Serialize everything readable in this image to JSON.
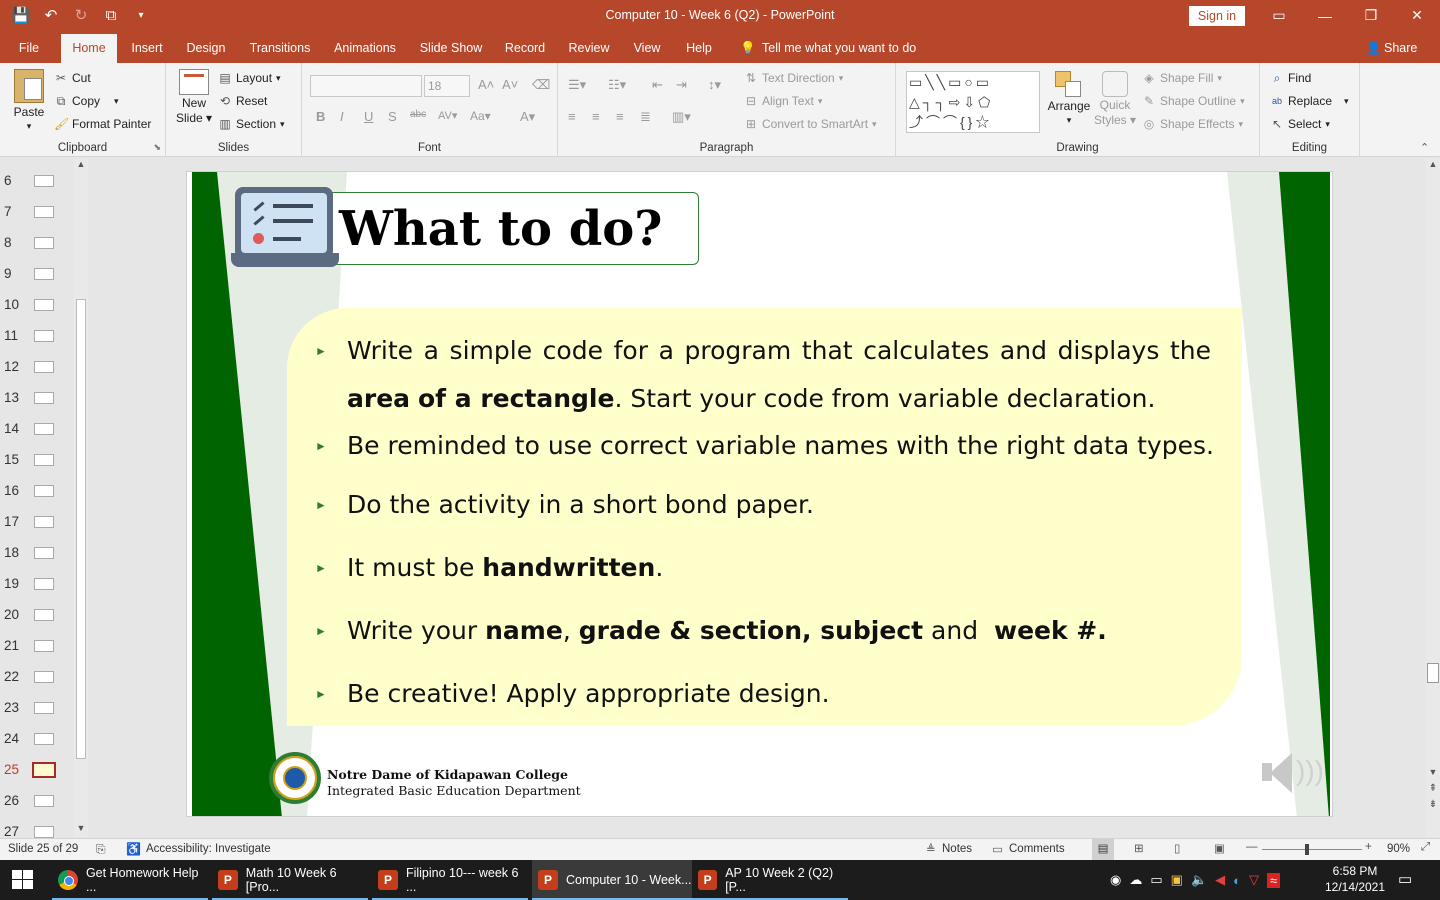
{
  "window": {
    "title": "Computer 10 - Week 6 (Q2)  -  PowerPoint",
    "sign_in": "Sign in"
  },
  "tabs": [
    "File",
    "Home",
    "Insert",
    "Design",
    "Transitions",
    "Animations",
    "Slide Show",
    "Record",
    "Review",
    "View",
    "Help"
  ],
  "active_tab": "Home",
  "tell_me": "Tell me what you want to do",
  "share": "Share",
  "ribbon": {
    "clipboard": {
      "label": "Clipboard",
      "paste": "Paste",
      "cut": "Cut",
      "copy": "Copy",
      "format_painter": "Format Painter"
    },
    "slides": {
      "label": "Slides",
      "new_slide_1": "New",
      "new_slide_2": "Slide",
      "layout": "Layout",
      "reset": "Reset",
      "section": "Section"
    },
    "font": {
      "label": "Font",
      "font_name": "",
      "font_size": "18"
    },
    "paragraph": {
      "label": "Paragraph",
      "text_direction": "Text Direction",
      "align_text": "Align Text",
      "convert_smartart": "Convert to SmartArt"
    },
    "drawing": {
      "label": "Drawing",
      "arrange": "Arrange",
      "quick_styles_1": "Quick",
      "quick_styles_2": "Styles",
      "shape_fill": "Shape Fill",
      "shape_outline": "Shape Outline",
      "shape_effects": "Shape Effects"
    },
    "editing": {
      "label": "Editing",
      "find": "Find",
      "replace": "Replace",
      "select": "Select"
    }
  },
  "thumbnails": [
    "6",
    "7",
    "8",
    "9",
    "10",
    "11",
    "12",
    "13",
    "14",
    "15",
    "16",
    "17",
    "18",
    "19",
    "20",
    "21",
    "22",
    "23",
    "24",
    "25",
    "26",
    "27"
  ],
  "active_slide_number": "25",
  "slide": {
    "title": "What to do?",
    "bullets": {
      "b1_a": "Write a simple code for a program that calculates and displays the ",
      "b1_bold1": "area",
      "b1_bold2": "of a rectangle",
      "b1_b": ". Start your code from variable declaration.",
      "b2": "Be reminded to use correct variable names with the right data types.",
      "b3": "Do the activity in a short bond paper.",
      "b4_a": "It must be ",
      "b4_bold": "handwritten",
      "b4_b": ".",
      "b5_a": "Write your ",
      "b5_bold1": "name",
      "b5_c": ", ",
      "b5_bold2": "grade & section, subject",
      "b5_d": " and  ",
      "b5_bold3": "week #."
    },
    "b6": "Be creative! Apply appropriate design.",
    "school_name": "Notre Dame of Kidapawan College",
    "school_dept": "Integrated Basic Education Department"
  },
  "status": {
    "slide_of": "Slide 25 of 29",
    "accessibility": "Accessibility: Investigate",
    "notes": "Notes",
    "comments": "Comments",
    "zoom": "90%",
    "zoom_level": 0.9
  },
  "taskbar": {
    "apps": [
      "Get Homework Help ...",
      "Math 10 Week 6 [Pro...",
      "Filipino 10--- week 6 ...",
      "Computer 10 - Week...",
      "AP 10 Week 2 (Q2) [P..."
    ],
    "time": "6:58 PM",
    "date": "12/14/2021"
  },
  "colors": {
    "accent": "#b7472a",
    "slide_green": "#006400",
    "content_bg": "#ffffcc",
    "taskbar": "#1c1c1c"
  }
}
